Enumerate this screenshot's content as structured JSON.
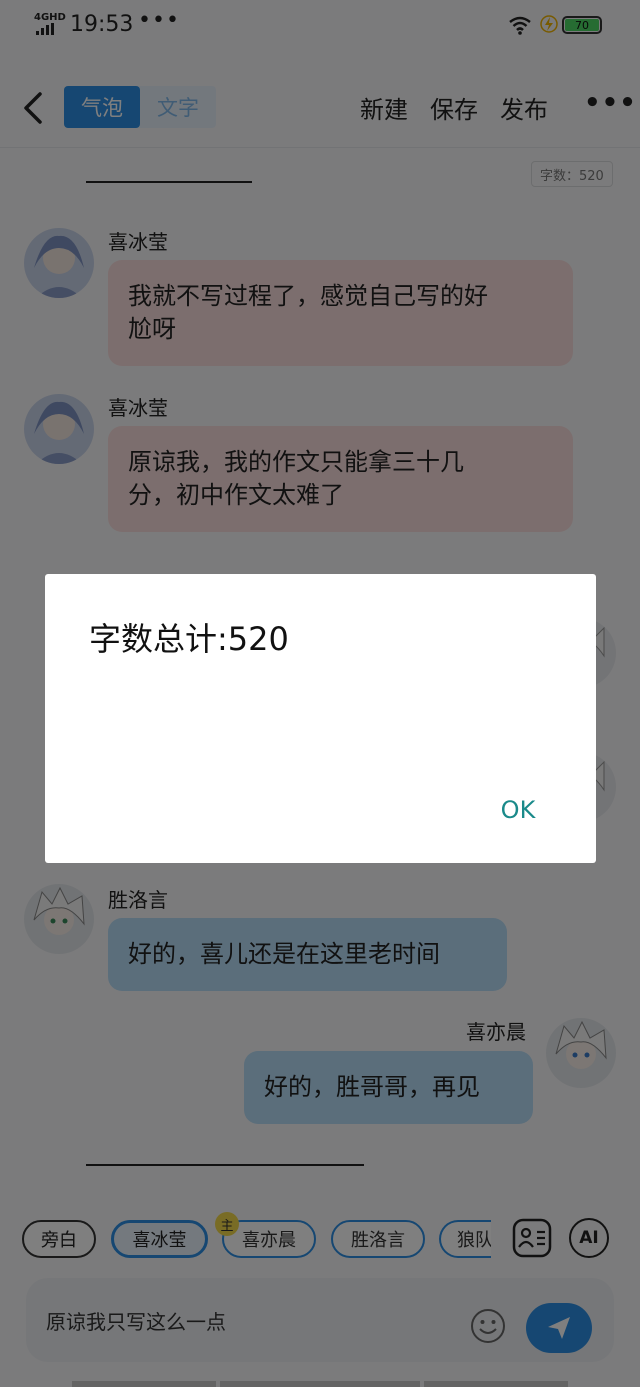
{
  "status_bar": {
    "network": "4GHD",
    "time": "19:53",
    "more": "•••",
    "battery_level": "70"
  },
  "topbar": {
    "modes": [
      "气泡",
      "文字"
    ],
    "actions": [
      "新建",
      "保存",
      "发布"
    ],
    "more": "•••"
  },
  "word_count_badge": "字数：520",
  "messages": [
    {
      "name": "喜冰莹",
      "text": "我就不写过程了，感觉自己写的好尬呀",
      "lines": [
        "我就不写过程了，感觉自己写的好",
        "尬呀"
      ]
    },
    {
      "name": "喜冰莹",
      "text": "原谅我，我的作文只能拿三十几分，初中作文太难了",
      "lines": [
        "原谅我，我的作文只能拿三十几",
        "分，初中作文太难了"
      ]
    },
    {
      "name": "胜洛言",
      "text": "好的，喜儿还是在这里老时间"
    },
    {
      "name": "喜亦晨",
      "text": "好的，胜哥哥，再见"
    }
  ],
  "dialog": {
    "title": "字数总计:520",
    "ok": "OK"
  },
  "roles": [
    "旁白",
    "喜冰莹",
    "喜亦晨",
    "胜洛言",
    "狼队"
  ],
  "main_tag": "主",
  "ai_label": "AI",
  "composer": {
    "text": "原谅我只写这么一点"
  },
  "colors": {
    "accent": "#2d8fe4",
    "bubble_pink": "#f8dcdc",
    "bubble_blue": "#b6dcf7",
    "dialog_button": "#1a8a8a"
  }
}
